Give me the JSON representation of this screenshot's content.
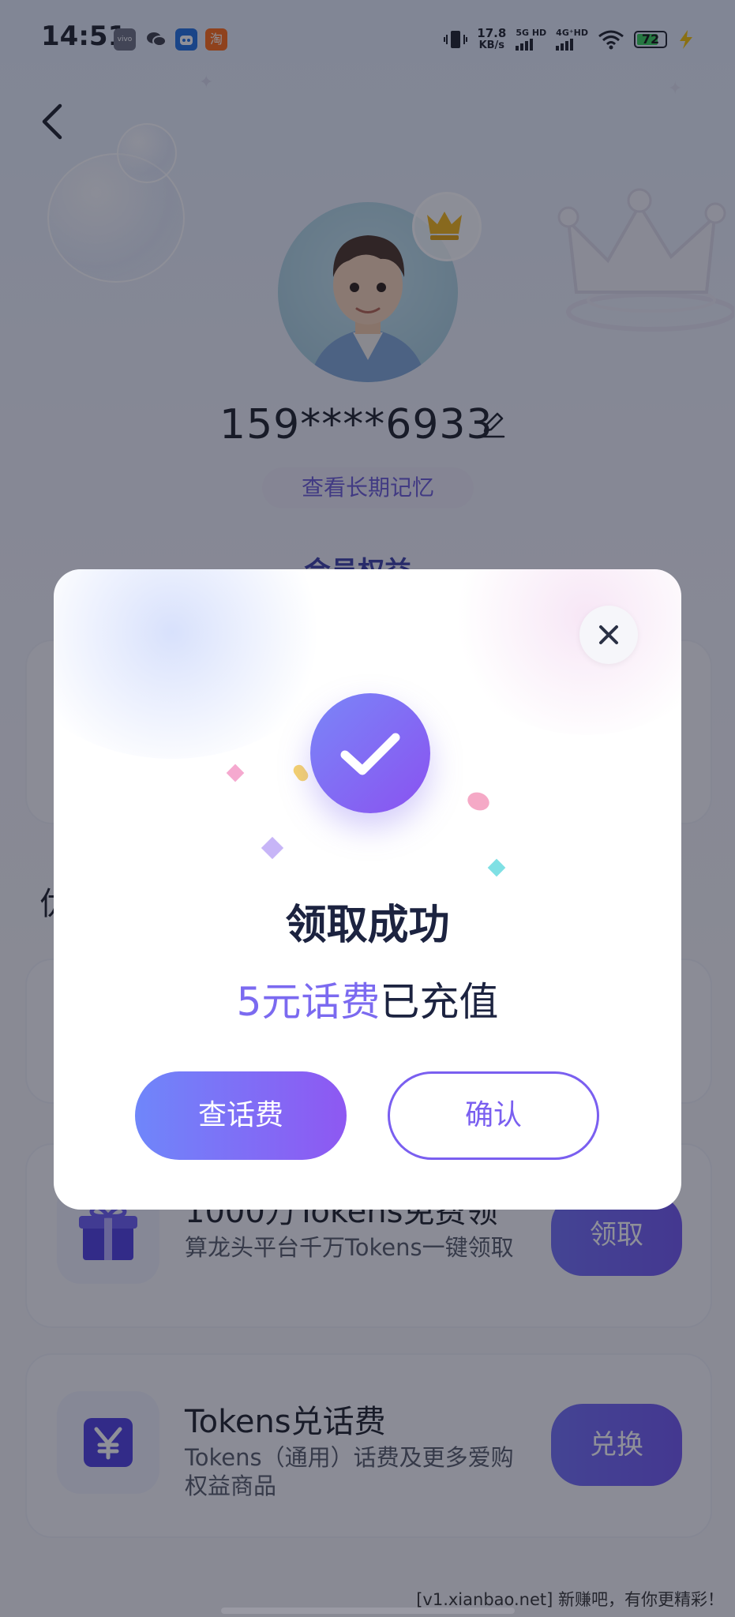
{
  "status_bar": {
    "time": "14:51",
    "apps": [
      "vivo",
      "wechat",
      "bot",
      "淘"
    ],
    "net_speed_value": "17.8",
    "net_speed_unit": "KB/s",
    "sim1": "5G HD",
    "sim2": "4G⁺HD",
    "battery": "72"
  },
  "profile": {
    "phone": "159****6933",
    "memory_button": "查看长期记忆",
    "section_title_peek": "会员权益",
    "left_peek": "优"
  },
  "cards": [
    {
      "title": "1000万Tokens免费领",
      "desc": "算龙头平台千万Tokens一键领取",
      "button": "领取",
      "icon": "gift-icon"
    },
    {
      "title": "Tokens兑话费",
      "desc": "Tokens（通用）话费及更多爱购权益商品",
      "button": "兑换",
      "icon": "yen-icon"
    }
  ],
  "dialog": {
    "title": "领取成功",
    "highlight": "5元话费",
    "subtitle_rest": "已充值",
    "primary_button": "查话费",
    "secondary_button": "确认"
  },
  "watermark": "[v1.xianbao.net] 新赚吧，有你更精彩！",
  "colors": {
    "accent": "#7a5ff0",
    "title": "#1c2340",
    "overlay": "rgba(20,22,40,0.48)"
  }
}
